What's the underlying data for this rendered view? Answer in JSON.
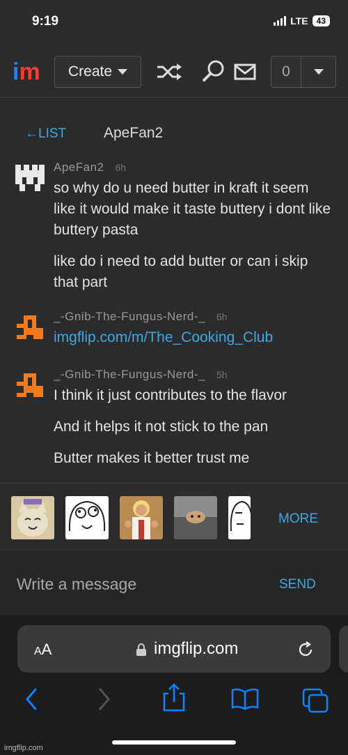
{
  "status_bar": {
    "time": "9:19",
    "network": "LTE",
    "battery": "43"
  },
  "header": {
    "logo_i": "i",
    "logo_m": "m",
    "create_label": "Create",
    "notification_count": "0"
  },
  "chat": {
    "back_label": "←LIST",
    "peer_name": "ApeFan2"
  },
  "messages": [
    {
      "author": "ApeFan2",
      "time": "6h",
      "lines": [
        "so why do u need butter in kraft it seem like it would make it taste buttery i dont like buttery pasta",
        "like do i need to add butter or can i skip that part"
      ]
    },
    {
      "author": "_-Gnib-The-Fungus-Nerd-_",
      "time": "6h",
      "link": "imgflip.com/m/The_Cooking_Club"
    },
    {
      "author": "_-Gnib-The-Fungus-Nerd-_",
      "time": "5h",
      "lines": [
        "I think it just contributes to the flavor",
        "And it helps it not stick to the pan",
        "Butter makes it better trust me"
      ]
    }
  ],
  "meme_tray": {
    "thumbnails": [
      "smiling-cat",
      "derp-face",
      "buddy-christ",
      "ceiling-cat",
      "okay-face"
    ],
    "more_label": "MORE"
  },
  "composer": {
    "placeholder": "Write a message",
    "send_label": "SEND"
  },
  "browser": {
    "text_size_label_small": "A",
    "text_size_label_large": "A",
    "domain": "imgflip.com"
  },
  "watermark": "imgflip.com",
  "colors": {
    "accent": "#3fa9e0",
    "logo_blue": "#2a84e8",
    "logo_red": "#ff3b2f",
    "avatar_orange": "#f27b1e",
    "ios_blue": "#0a84ff"
  }
}
